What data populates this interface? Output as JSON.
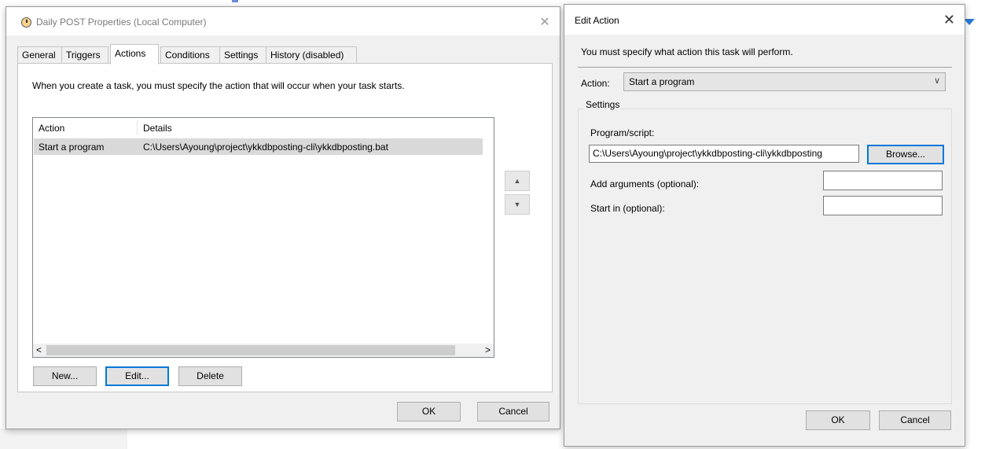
{
  "properties_dialog": {
    "title": "Daily POST Properties (Local Computer)",
    "close_glyph": "✕",
    "tabs": [
      {
        "label": "General"
      },
      {
        "label": "Triggers"
      },
      {
        "label": "Actions",
        "active": true
      },
      {
        "label": "Conditions"
      },
      {
        "label": "Settings"
      },
      {
        "label": "History (disabled)"
      }
    ],
    "intro_text": "When you create a task, you must specify the action that will occur when your task starts.",
    "actions_table": {
      "columns": [
        "Action",
        "Details"
      ],
      "rows": [
        {
          "action": "Start a program",
          "details": "C:\\Users\\Ayoung\\project\\ykkdbposting-cli\\ykkdbposting.bat"
        }
      ]
    },
    "buttons": {
      "new": "New...",
      "edit": "Edit...",
      "delete": "Delete",
      "ok": "OK",
      "cancel": "Cancel"
    },
    "scroll_left": "<",
    "scroll_right": ">",
    "move_up": "▲",
    "move_down": "▼"
  },
  "edit_action_dialog": {
    "title": "Edit Action",
    "close_glyph": "✕",
    "instruction": "You must specify what action this task will perform.",
    "action_label": "Action:",
    "action_value": "Start a program",
    "dropdown_glyph": "∨",
    "settings_legend": "Settings",
    "program_label": "Program/script:",
    "program_value": "C:\\Users\\Ayoung\\project\\ykkdbposting-cli\\ykkdbposting",
    "browse_button": "Browse...",
    "arguments_label": "Add arguments (optional):",
    "arguments_value": "",
    "start_in_label": "Start in (optional):",
    "start_in_value": "",
    "ok_button": "OK",
    "cancel_button": "Cancel"
  }
}
